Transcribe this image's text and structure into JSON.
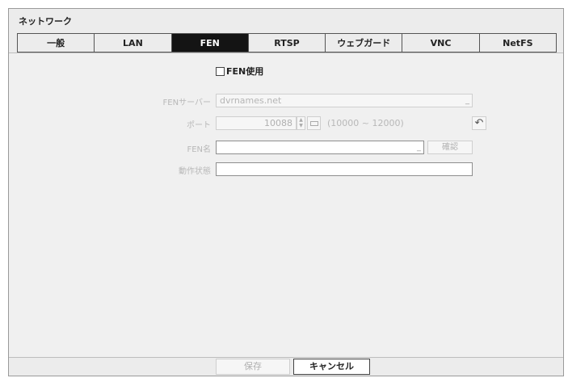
{
  "window": {
    "title": "ネットワーク"
  },
  "tabs": [
    {
      "label": "一般",
      "active": false
    },
    {
      "label": "LAN",
      "active": false
    },
    {
      "label": "FEN",
      "active": true
    },
    {
      "label": "RTSP",
      "active": false
    },
    {
      "label": "ウェブガード",
      "active": false
    },
    {
      "label": "VNC",
      "active": false
    },
    {
      "label": "NetFS",
      "active": false
    }
  ],
  "form": {
    "use_fen_label": "FEN使用",
    "use_fen_checked": false,
    "fen_server": {
      "label": "FENサーバー",
      "value": "dvrnames.net",
      "suffix": "_"
    },
    "port": {
      "label": "ポート",
      "value": "10088",
      "range": "(10000 ~ 12000)"
    },
    "fen_name": {
      "label": "FEN名",
      "value": "",
      "suffix": "_",
      "confirm_label": "確認"
    },
    "status": {
      "label": "動作状態",
      "value": ""
    }
  },
  "footer": {
    "save_label": "保存",
    "cancel_label": "キャンセル"
  },
  "icons": {
    "spinner": "spinner-arrows-icon",
    "keyboard": "keyboard-icon",
    "reset": "undo-arrow-icon"
  },
  "colors": {
    "active_tab_bg": "#141414",
    "active_tab_text": "#ffffff",
    "disabled_text": "#b8b8b8"
  }
}
